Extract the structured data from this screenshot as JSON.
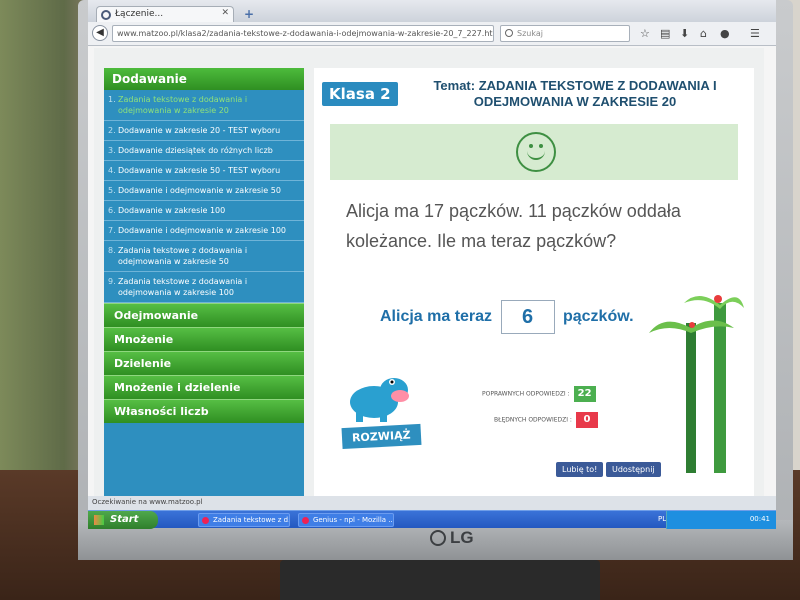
{
  "browser": {
    "tab_title": "Łączenie...",
    "new_tab_symbol": "+",
    "close_tab_symbol": "✕",
    "url": "www.matzoo.pl/klasa2/zadania-tekstowe-z-dodawania-i-odejmowania-w-zakresie-20_7_227.html#task",
    "search_placeholder": "Szukaj",
    "status_text": "Oczekiwanie na www.matzoo.pl"
  },
  "sidebar": {
    "heading": "Dodawanie",
    "items": [
      {
        "num": "1.",
        "label": "Zadania tekstowe z dodawania i odejmowania w zakresie 20",
        "active": true
      },
      {
        "num": "2.",
        "label": "Dodawanie w zakresie 20 - TEST wyboru"
      },
      {
        "num": "3.",
        "label": "Dodawanie dziesiątek do różnych liczb"
      },
      {
        "num": "4.",
        "label": "Dodawanie w zakresie 50 - TEST wyboru"
      },
      {
        "num": "5.",
        "label": "Dodawanie i odejmowanie w zakresie 50"
      },
      {
        "num": "6.",
        "label": "Dodawanie w zakresie 100"
      },
      {
        "num": "7.",
        "label": "Dodawanie i odejmowanie w zakresie 100"
      },
      {
        "num": "8.",
        "label": "Zadania tekstowe z dodawania i odejmowania w zakresie 50"
      },
      {
        "num": "9.",
        "label": "Zadania tekstowe z dodawania i odejmowania w zakresie 100"
      }
    ],
    "categories": [
      "Odejmowanie",
      "Mnożenie",
      "Dzielenie",
      "Mnożenie i dzielenie",
      "Własności liczb"
    ]
  },
  "content": {
    "class_badge": "Klasa 2",
    "topic": "Temat: ZADANIA TEKSTOWE Z DODAWANIA I ODEJMOWANIA W ZAKRESIE 20",
    "question": "Alicja ma 17 pączków. 11 pączków oddała koleżance. Ile ma teraz pączków?",
    "answer_prefix": "Alicja ma teraz",
    "answer_value": "6",
    "answer_suffix": "pączków.",
    "solve_button": "ROZWIĄŻ",
    "correct_label": "POPRAWNYCH ODPOWIEDZI :",
    "correct_value": "22",
    "wrong_label": "BŁĘDNYCH ODPOWIEDZI :",
    "wrong_value": "0",
    "like_button": "Lubię to!",
    "share_button": "Udostępnij"
  },
  "taskbar": {
    "start_label": "Start",
    "tasks": [
      "Zadania tekstowe z d...",
      "Genius - npl - Mozilla ..."
    ],
    "language": "PL",
    "clock": "00:41"
  },
  "monitor": {
    "brand": "LG"
  },
  "colors": {
    "sidebar_blue": "#2e8fbf",
    "category_green": "#3fa52f",
    "correct_green": "#4caf50",
    "wrong_red": "#e8394a"
  }
}
